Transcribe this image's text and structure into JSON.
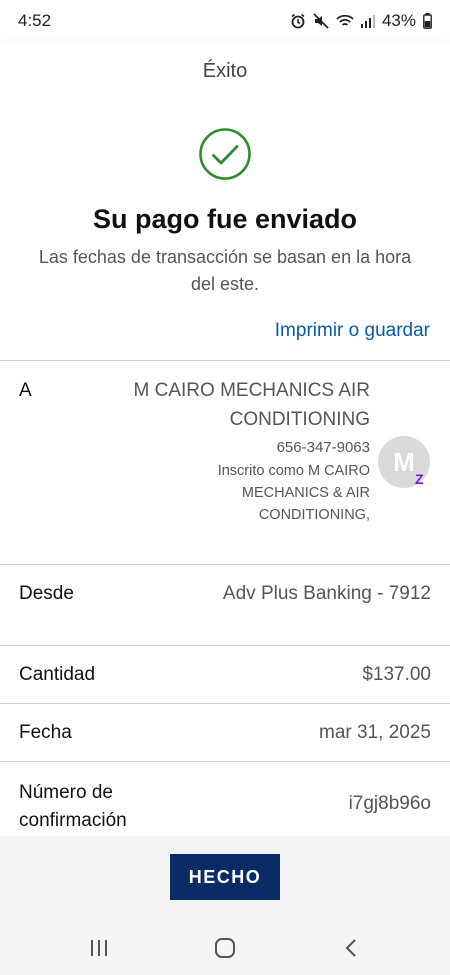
{
  "status_bar": {
    "time": "4:52",
    "battery": "43%",
    "icons": [
      "alarm-icon",
      "mute-icon",
      "wifi-icon",
      "signal-icon",
      "battery-icon"
    ]
  },
  "header": {
    "title": "Éxito"
  },
  "success": {
    "icon": "check-circle-icon",
    "title": "Su pago fue enviado",
    "subtitle": "Las fechas de transacción se basan en la hora del este.",
    "print_link": "Imprimir o guardar"
  },
  "details": {
    "to": {
      "label": "A",
      "payee_name": "M CAIRO MECHANICS AIR CONDITIONING",
      "phone": "656-347-9063",
      "enrolled_as": "Inscrito como M CAIRO MECHANICS & AIR CONDITIONING,",
      "avatar_letter": "M",
      "badge_icon": "zelle-icon",
      "badge_text": "Z"
    },
    "from": {
      "label": "Desde",
      "value": "Adv Plus Banking - 7912"
    },
    "amount": {
      "label": "Cantidad",
      "value": "$137.00"
    },
    "date": {
      "label": "Fecha",
      "value": "mar 31, 2025"
    },
    "confirmation": {
      "label": "Número de confirmación",
      "value": "i7gj8b96o"
    }
  },
  "actions": {
    "done_label": "HECHO"
  },
  "nav_bar": {
    "icons": [
      "recent-apps-icon",
      "home-icon",
      "back-icon"
    ]
  },
  "colors": {
    "success_green": "#2e8b2e",
    "link_blue": "#0a5aa8",
    "button_navy": "#0b2b66",
    "zelle_purple": "#6d1ed4"
  }
}
